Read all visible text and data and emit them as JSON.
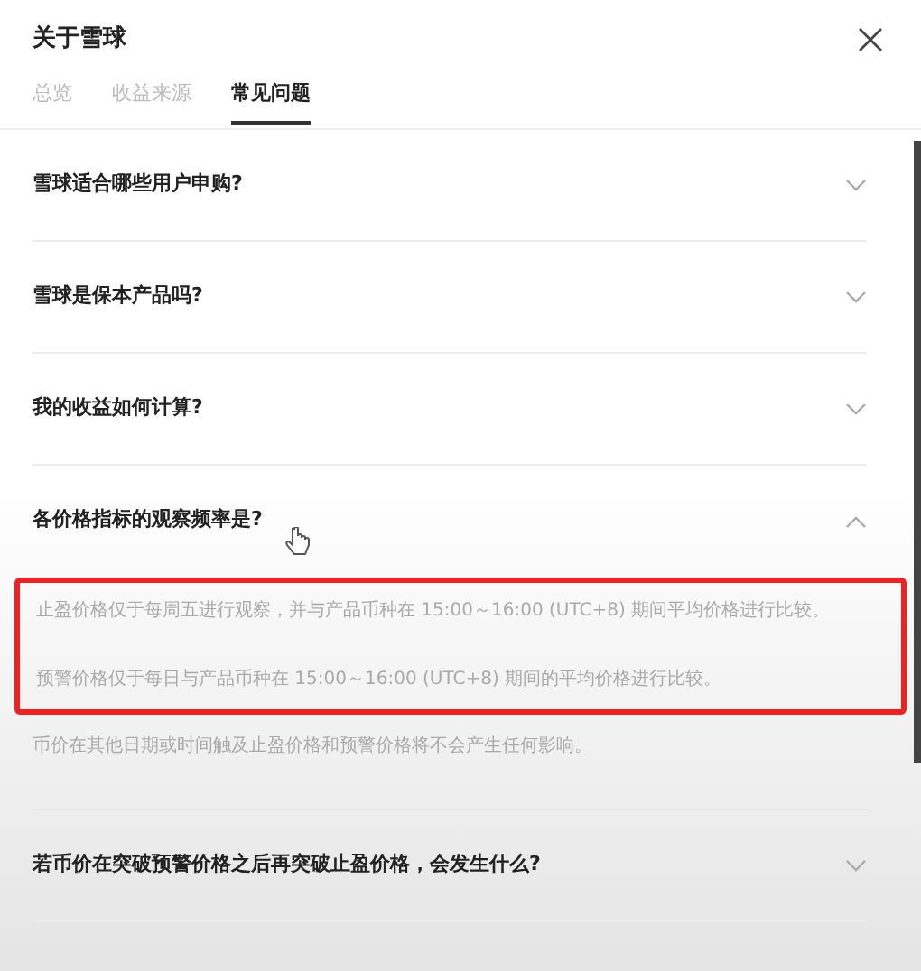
{
  "dialog": {
    "title": "关于雪球"
  },
  "tabs": [
    {
      "label": "总览",
      "selected": false
    },
    {
      "label": "收益来源",
      "selected": false
    },
    {
      "label": "常见问题",
      "selected": true
    }
  ],
  "faq": [
    {
      "question": "雪球适合哪些用户申购?",
      "expanded": false
    },
    {
      "question": "雪球是保本产品吗?",
      "expanded": false
    },
    {
      "question": "我的收益如何计算?",
      "expanded": false
    },
    {
      "question": "各价格指标的观察频率是?",
      "expanded": true,
      "answers": [
        {
          "text": "止盈价格仅于每周五进行观察，并与产品币种在 15:00～16:00 (UTC+8) 期间平均价格进行比较。",
          "highlighted": true
        },
        {
          "text": "预警价格仅于每日与产品币种在 15:00～16:00 (UTC+8) 期间的平均价格进行比较。",
          "highlighted": true
        },
        {
          "text": "币价在其他日期或时间触及止盈价格和预警价格将不会产生任何影响。",
          "highlighted": false
        }
      ]
    },
    {
      "question": "若币价在突破预警价格之后再突破止盈价格，会发生什么?",
      "expanded": false
    }
  ]
}
